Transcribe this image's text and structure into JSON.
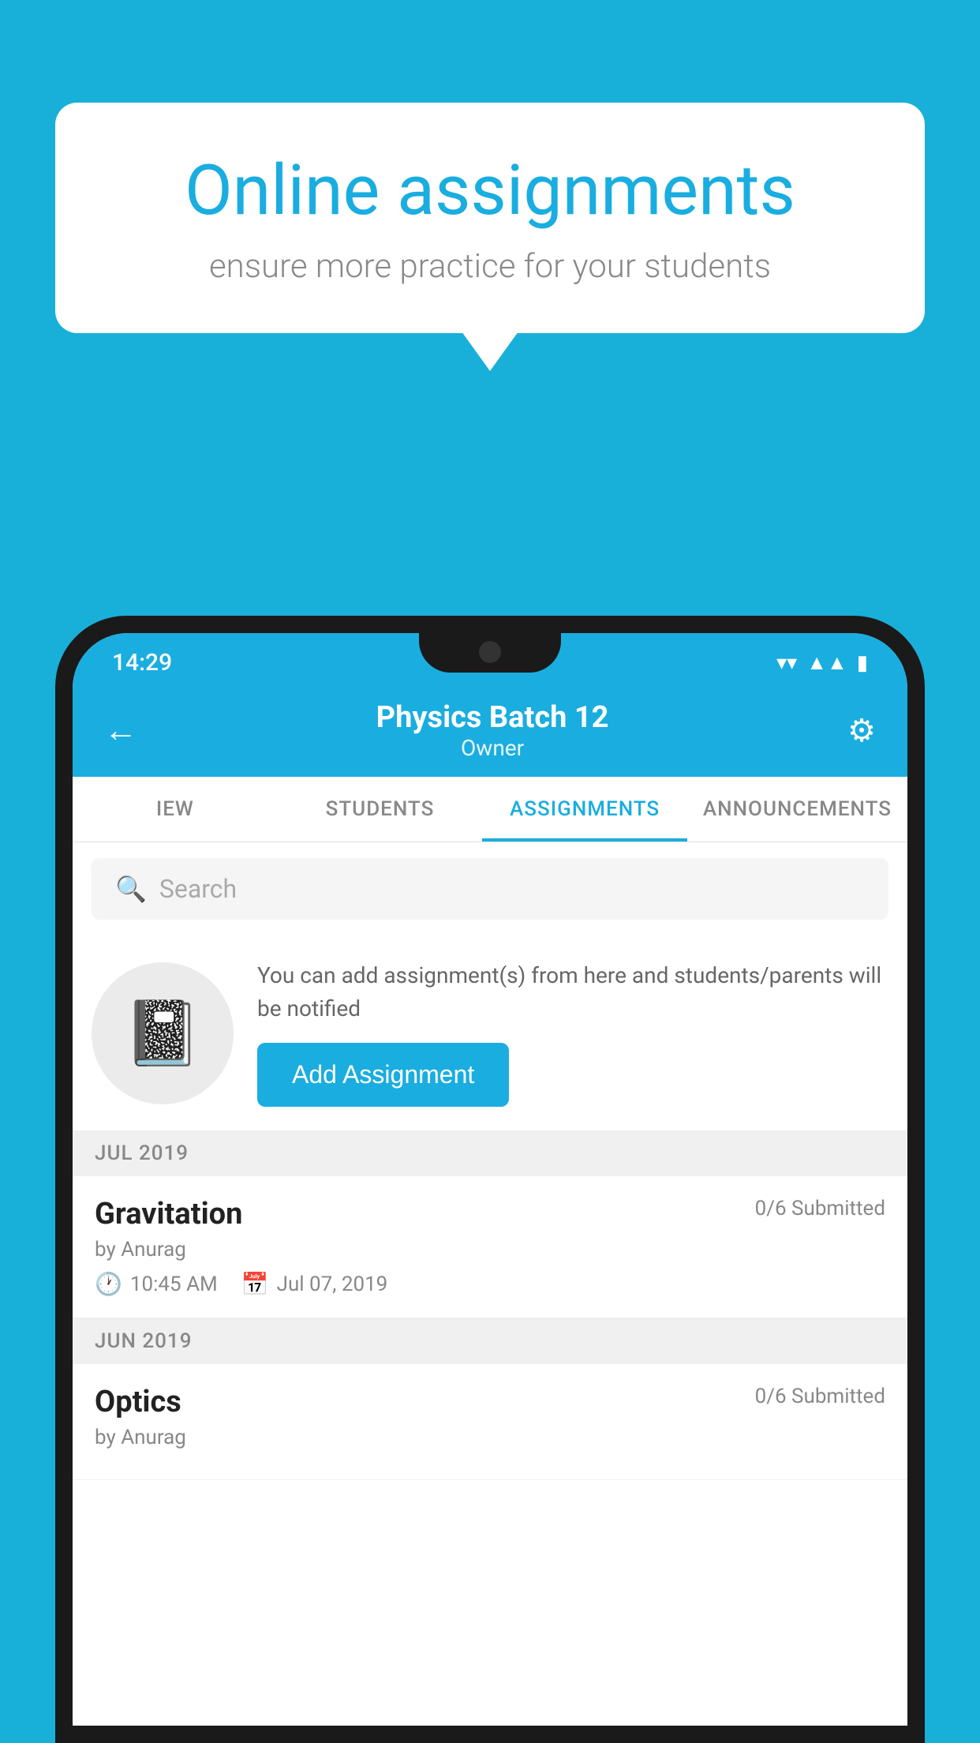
{
  "background_color": "#18b0d8",
  "speech_bubble": {
    "title": "Online assignments",
    "subtitle": "ensure more practice for your students"
  },
  "status_bar": {
    "time": "14:29",
    "wifi": "▼",
    "signal": "◀",
    "battery": "▮"
  },
  "app_header": {
    "title": "Physics Batch 12",
    "subtitle": "Owner",
    "back_label": "←",
    "settings_label": "⚙"
  },
  "tabs": [
    {
      "label": "IEW",
      "active": false
    },
    {
      "label": "STUDENTS",
      "active": false
    },
    {
      "label": "ASSIGNMENTS",
      "active": true
    },
    {
      "label": "ANNOUNCEMENTS",
      "active": false
    }
  ],
  "search": {
    "placeholder": "Search"
  },
  "promo": {
    "icon": "📓",
    "text": "You can add assignment(s) from here and students/parents will be notified",
    "button_label": "Add Assignment"
  },
  "sections": [
    {
      "label": "JUL 2019",
      "assignments": [
        {
          "title": "Gravitation",
          "submitted": "0/6 Submitted",
          "by": "by Anurag",
          "time": "10:45 AM",
          "date": "Jul 07, 2019"
        }
      ]
    },
    {
      "label": "JUN 2019",
      "assignments": [
        {
          "title": "Optics",
          "submitted": "0/6 Submitted",
          "by": "by Anurag",
          "time": "",
          "date": ""
        }
      ]
    }
  ]
}
